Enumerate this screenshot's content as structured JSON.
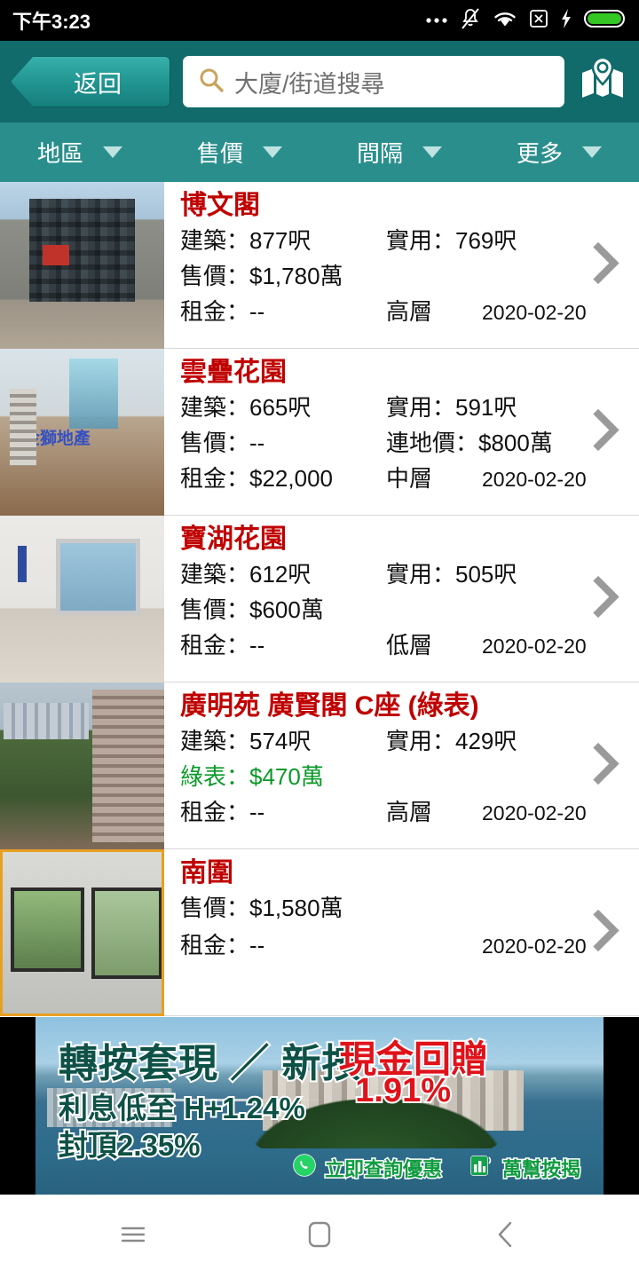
{
  "statusbar": {
    "time": "下午3:23",
    "icons": [
      "more-dots-icon",
      "bell-muted-icon",
      "wifi-icon",
      "no-sim-icon",
      "charging-bolt-icon",
      "battery-full-icon"
    ],
    "battery_color": "#34c724"
  },
  "header": {
    "back_label": "返回",
    "search_placeholder": "大廈/街道搜尋",
    "search_value": "",
    "search_icon": "search-icon",
    "map_icon": "map-pin-icon",
    "bg_color": "#116b6b",
    "accent_color": "#2a8f8c"
  },
  "filters": [
    {
      "label": "地區"
    },
    {
      "label": "售價"
    },
    {
      "label": "間隔"
    },
    {
      "label": "更多"
    }
  ],
  "labels": {
    "gross": "建築：",
    "net": "實用：",
    "price": "售價：",
    "rent": "租金：",
    "land_price": "連地價：",
    "green_form": "綠表：",
    "empty": "--"
  },
  "listings": [
    {
      "title": "博文閣",
      "gross": "建築：877呎",
      "net": "實用：769呎",
      "price": "售價：$1,780萬",
      "price2": "",
      "rent": "租金：--",
      "floor": "高層",
      "date": "2020-02-20",
      "price_is_green": false,
      "thumb": "building-exterior-photo",
      "thumb_class": "t1"
    },
    {
      "title": "雲疊花園",
      "gross": "建築：665呎",
      "net": "實用：591呎",
      "price": "售價：--",
      "price2": "連地價：$800萬",
      "rent": "租金：$22,000",
      "floor": "中層",
      "date": "2020-02-20",
      "price_is_green": false,
      "thumb": "interior-chandelier-photo",
      "thumb_watermark": "金獅地產",
      "thumb_class": "t2"
    },
    {
      "title": "寶湖花園",
      "gross": "建築：612呎",
      "net": "實用：505呎",
      "price": "售價：$600萬",
      "price2": "",
      "rent": "租金：--",
      "floor": "低層",
      "date": "2020-02-20",
      "price_is_green": false,
      "thumb": "empty-bedroom-photo",
      "thumb_class": "t3"
    },
    {
      "title": "廣明苑 廣賢閣 C座 (綠表)",
      "gross": "建築：574呎",
      "net": "實用：429呎",
      "price": "綠表：$470萬",
      "price2": "",
      "rent": "租金：--",
      "floor": "高層",
      "date": "2020-02-20",
      "price_is_green": true,
      "thumb": "city-view-photo",
      "thumb_class": "t4"
    },
    {
      "title": "南圍",
      "gross": "",
      "net": "",
      "price": "售價：$1,580萬",
      "price2": "",
      "rent": "租金：--",
      "floor": "",
      "date": "2020-02-20",
      "price_is_green": false,
      "thumb": "corner-window-room-photo",
      "thumb_class": "t5",
      "thumb_selected": true
    }
  ],
  "colors": {
    "title_red": "#c00000",
    "green_price": "#0a9a28",
    "chevron_gray": "#9a9a9a",
    "banner_green": "#0e5146",
    "banner_red": "#e0121a"
  },
  "banner": {
    "headline": "轉按套現 ／ 新按",
    "sub1": "利息低至 H+1.24%",
    "sub2": "封頂2.35%",
    "cashback_title": "現金回贈",
    "cashback_value": "1.91%",
    "cta_label": "立即查詢優惠",
    "brand_label": "萬幫按揭",
    "whatsapp_icon": "whatsapp-icon",
    "brand_icon": "app-logo-icon"
  },
  "navbar": {
    "recents_icon": "menu-icon",
    "home_icon": "home-square-icon",
    "back_icon": "back-chevron-icon"
  }
}
